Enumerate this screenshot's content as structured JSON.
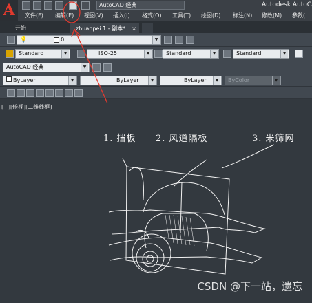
{
  "window": {
    "title": "Autodesk AutoCA",
    "workspace": "AutoCAD 经典"
  },
  "colors": {
    "accent": "#e23a2e",
    "canvas": "#33393f",
    "annotation": "#e43a2f"
  },
  "menu": [
    "文件(F)",
    "编辑(E)",
    "视图(V)",
    "插入(I)",
    "格式(O)",
    "工具(T)",
    "绘图(D)",
    "标注(N)",
    "修改(M)",
    "参数("
  ],
  "tabs": [
    {
      "label": "开始",
      "active": false
    },
    {
      "label": "zhuanpei 1 - 副本*",
      "active": true
    }
  ],
  "layer": {
    "value": "0"
  },
  "styles": {
    "text": "Standard",
    "dim": "ISO-25",
    "table": "Standard",
    "mleader": "Standard"
  },
  "workspace_combo": "AutoCAD 经典",
  "properties": {
    "color": "ByLayer",
    "linetype": "ByLayer",
    "lineweight": "ByLayer",
    "plotstyle": "ByColor"
  },
  "viewport": {
    "label": "[−][俯视][二维线框]"
  },
  "drawing_labels": [
    "1. 挡板",
    "2. 风道隔板",
    "3. 米筛网"
  ],
  "watermark": "CSDN @下一站，遗忘"
}
